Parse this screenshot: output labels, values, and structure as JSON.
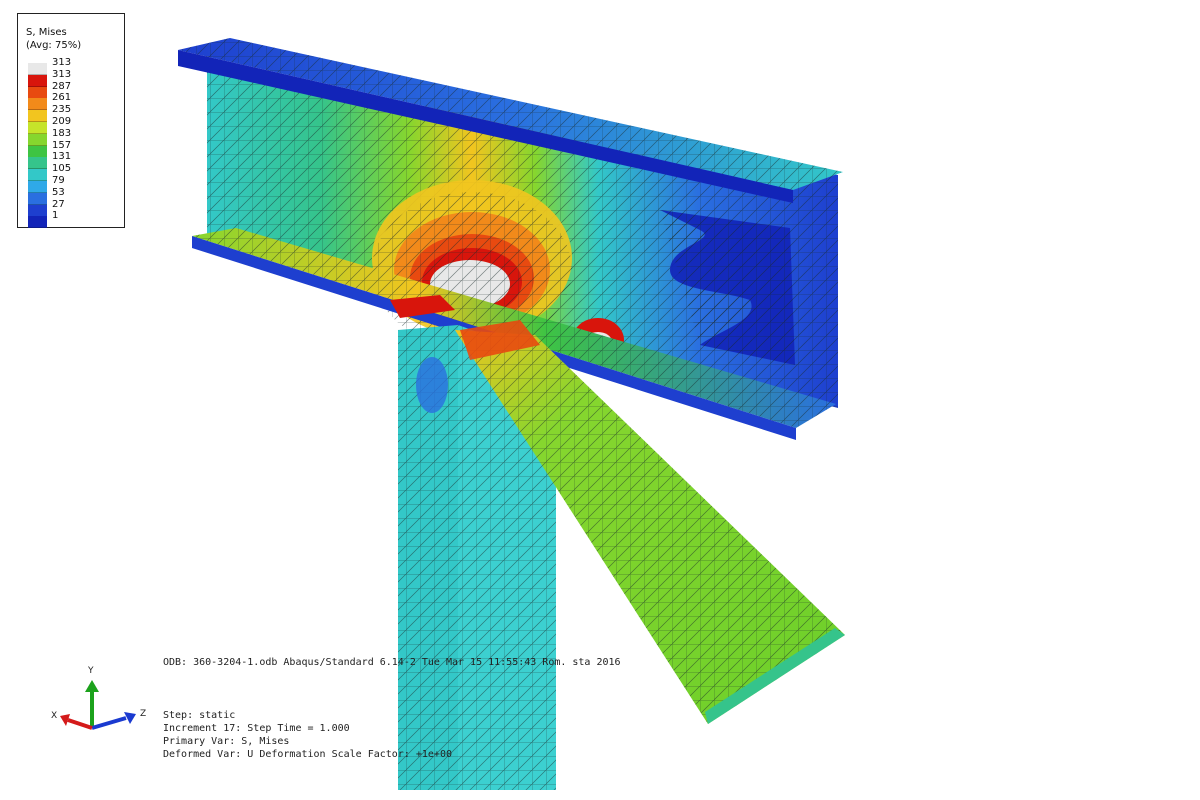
{
  "legend": {
    "title_line1": "S, Mises",
    "title_line2": "(Avg: 75%)",
    "entries": [
      {
        "value": "313",
        "color": "#e8e8e8"
      },
      {
        "value": "313",
        "color": "#d8150c"
      },
      {
        "value": "287",
        "color": "#e84a10"
      },
      {
        "value": "261",
        "color": "#f28a1a"
      },
      {
        "value": "235",
        "color": "#f2c51f"
      },
      {
        "value": "209",
        "color": "#c6e42a"
      },
      {
        "value": "183",
        "color": "#86d62e"
      },
      {
        "value": "157",
        "color": "#3ec443"
      },
      {
        "value": "131",
        "color": "#35c48b"
      },
      {
        "value": "105",
        "color": "#33c8c8"
      },
      {
        "value": "79",
        "color": "#2fa9e8"
      },
      {
        "value": "53",
        "color": "#2a6fe0"
      },
      {
        "value": "27",
        "color": "#1e3fcf"
      },
      {
        "value": "1",
        "color": "#1224b8"
      }
    ]
  },
  "info": {
    "odb_line": "ODB: 360-3204-1.odb   Abaqus/Standard 6.14-2   Tue Mar 15 11:55:43 Rom. sta 2016",
    "step_line": "Step: static",
    "increment_line": "Increment    17: Step Time =    1.000",
    "primary_var_line": "Primary Var: S, Mises",
    "deformed_var_line": "Deformed Var: U   Deformation Scale Factor: +1e+00"
  },
  "triad": {
    "y_label": "Y",
    "x_label": "X",
    "z_label": "Z"
  },
  "colors": {
    "dark_blue": "#1224b8",
    "blue": "#1e3fcf",
    "cyan": "#33c8c8",
    "green": "#3ec443",
    "yellow_green": "#86d62e",
    "orange": "#f28a1a",
    "red": "#d8150c",
    "white": "#e8e8e8"
  }
}
